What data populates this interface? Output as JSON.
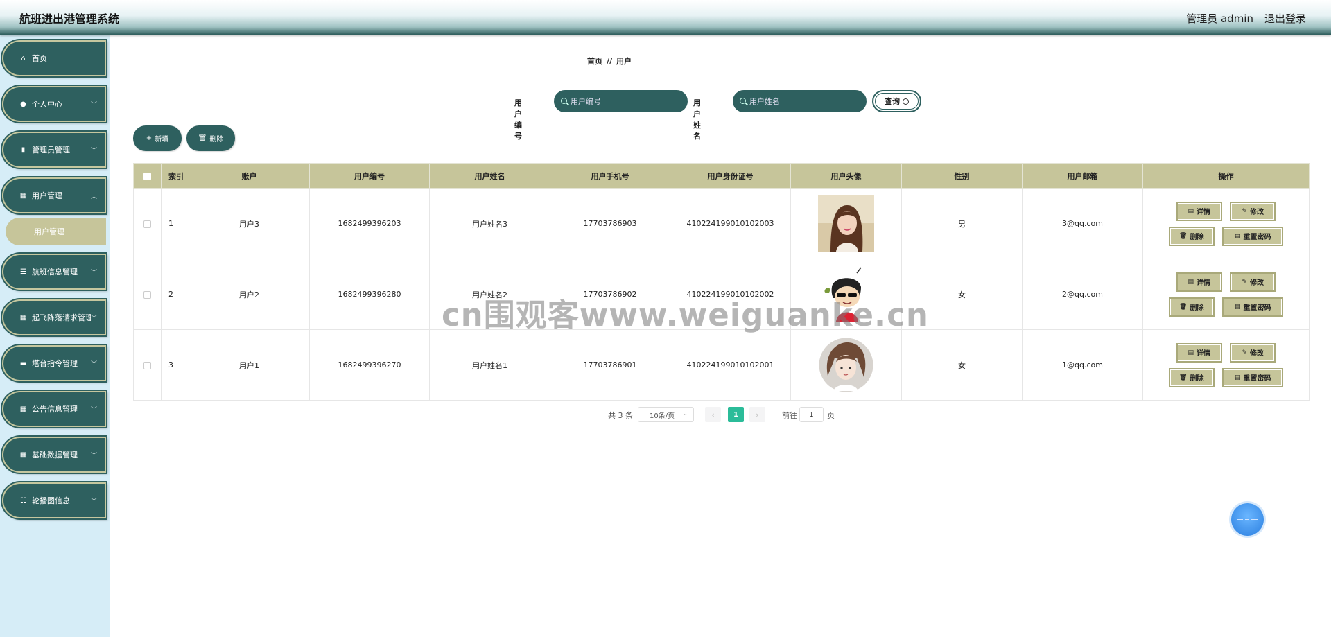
{
  "header": {
    "title": "航班进出港管理系统",
    "user": "管理员 admin",
    "logout": "退出登录"
  },
  "sidebar": {
    "items": [
      {
        "label": "首页",
        "icon": "home-icon",
        "glyph": "⌂",
        "arrow": ""
      },
      {
        "label": "个人中心",
        "icon": "user-icon",
        "glyph": "●",
        "arrow": "﹀"
      },
      {
        "label": "管理员管理",
        "icon": "bar-chart-icon",
        "glyph": "▮",
        "arrow": "﹀"
      },
      {
        "label": "用户管理",
        "icon": "grid-icon",
        "glyph": "▦",
        "arrow": "︿"
      },
      {
        "label": "航班信息管理",
        "icon": "list-icon",
        "glyph": "☰",
        "arrow": "﹀"
      },
      {
        "label": "起飞降落请求管理",
        "icon": "grid-icon",
        "glyph": "▦",
        "arrow": "﹀"
      },
      {
        "label": "塔台指令管理",
        "icon": "briefcase-icon",
        "glyph": "▬",
        "arrow": "﹀"
      },
      {
        "label": "公告信息管理",
        "icon": "grid-icon",
        "glyph": "▦",
        "arrow": "﹀"
      },
      {
        "label": "基础数据管理",
        "icon": "grid-icon",
        "glyph": "▦",
        "arrow": "﹀"
      },
      {
        "label": "轮播图信息",
        "icon": "sliders-icon",
        "glyph": "☷",
        "arrow": "﹀"
      }
    ],
    "submenu": {
      "label": "用户管理"
    }
  },
  "breadcrumb": {
    "home": "首页",
    "sep": "//",
    "current": "用户"
  },
  "search": {
    "label1": "用户编号",
    "placeholder1": "用户编号",
    "label2": "用户姓名",
    "placeholder2": "用户姓名",
    "query": "查询"
  },
  "actions": {
    "add": "新增",
    "delete": "删除"
  },
  "table": {
    "headers": [
      "索引",
      "账户",
      "用户编号",
      "用户姓名",
      "用户手机号",
      "用户身份证号",
      "用户头像",
      "性别",
      "用户邮箱",
      "操作"
    ],
    "rows": [
      {
        "index": "1",
        "account": "用户3",
        "number": "1682499396203",
        "name": "用户姓名3",
        "phone": "17703786903",
        "idcard": "410224199010102003",
        "gender": "男",
        "email": "3@qq.com",
        "avatar": "photo-girl-avatar"
      },
      {
        "index": "2",
        "account": "用户2",
        "number": "1682499396280",
        "name": "用户姓名2",
        "phone": "17703786902",
        "idcard": "410224199010102002",
        "gender": "女",
        "email": "2@qq.com",
        "avatar": "cartoon-boy-avatar"
      },
      {
        "index": "3",
        "account": "用户1",
        "number": "1682499396270",
        "name": "用户姓名1",
        "phone": "17703786901",
        "idcard": "410224199010102001",
        "gender": "女",
        "email": "1@qq.com",
        "avatar": "illustrated-girl-avatar"
      }
    ],
    "ops": {
      "detail": "详情",
      "edit": "修改",
      "delete": "删除",
      "reset": "重置密码"
    }
  },
  "pagination": {
    "total": "共 3 条",
    "page_size": "10条/页",
    "current": "1",
    "goto": "前往",
    "page_input": "1",
    "page_suffix": "页"
  },
  "watermark": "cn围观客www.weiguanke.cn",
  "colors": {
    "primary": "#2e605f",
    "accent": "#c6c59a",
    "sidebar_bg": "#d6edf7",
    "pager_active": "#2bbc99"
  }
}
